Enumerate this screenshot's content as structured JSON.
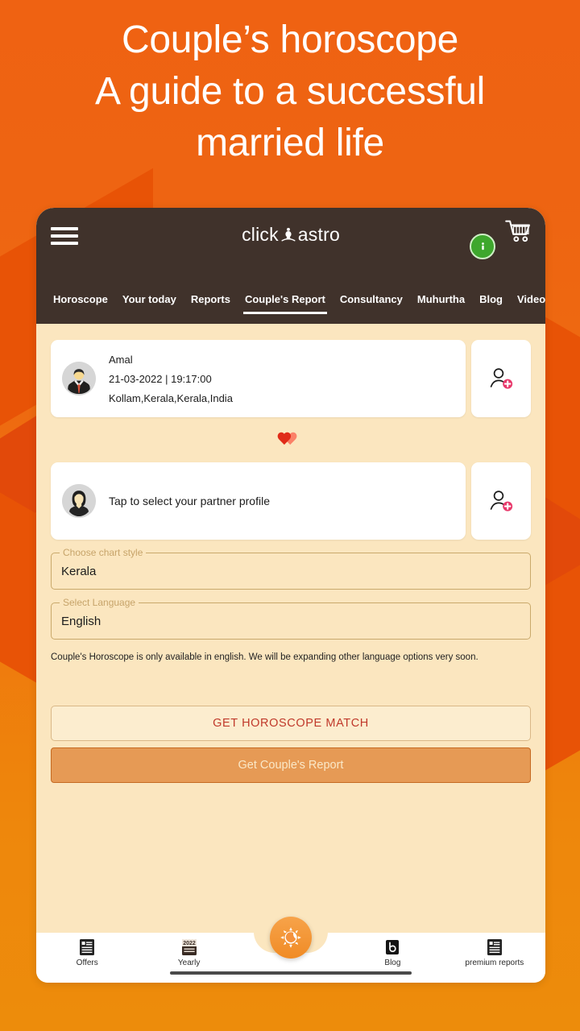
{
  "headline": {
    "line1": "Couple’s horoscope",
    "line2": "A guide to a successful",
    "line3": "married life"
  },
  "appbar": {
    "menu_icon": "hamburger-menu-icon",
    "logo_prefix": "click",
    "logo_suffix": "astro",
    "logo_glyph": "astro-figure-icon",
    "info_badge_label": "i",
    "cart_icon": "shopping-cart-icon"
  },
  "nav_tabs": [
    {
      "label": "Horoscope",
      "active": false
    },
    {
      "label": "Your today",
      "active": false
    },
    {
      "label": "Reports",
      "active": false
    },
    {
      "label": "Couple's Report",
      "active": true
    },
    {
      "label": "Consultancy",
      "active": false
    },
    {
      "label": "Muhurtha",
      "active": false
    },
    {
      "label": "Blog",
      "active": false
    },
    {
      "label": "Videos",
      "active": false
    }
  ],
  "self_profile": {
    "avatar": "male-avatar",
    "name": "Amal",
    "datetime": "21-03-2022 | 19:17:00",
    "place": "Kollam,Kerala,Kerala,India",
    "add_button_icon": "add-person-icon"
  },
  "hearts_icon": "two-hearts-icon",
  "partner_profile": {
    "avatar": "female-avatar",
    "placeholder": "Tap to select your partner profile",
    "add_button_icon": "add-person-icon"
  },
  "fields": [
    {
      "label": "Choose chart style",
      "value": "Kerala"
    },
    {
      "label": "Select Language",
      "value": "English"
    }
  ],
  "helper_text": "Couple's Horoscope is only available in english. We will be expanding other language options very soon.",
  "buttons": {
    "match": "GET HOROSCOPE MATCH",
    "report": "Get Couple's Report"
  },
  "bottom_nav": [
    {
      "label": "Offers",
      "icon": "list-document-icon"
    },
    {
      "label": "Yearly",
      "icon": "calendar-2022-icon",
      "badge": "2022"
    },
    {
      "label": "Blog",
      "icon": "blog-b-icon"
    },
    {
      "label": "premium reports",
      "icon": "list-document-icon"
    }
  ],
  "fab": {
    "icon": "sun-moon-icon"
  },
  "colors": {
    "background_top": "#EF6212",
    "background_bottom": "#ED8C0B",
    "appbar": "#40322B",
    "panel": "#FBE6BF",
    "accent_orange": "#E69A55",
    "match_text": "#C0392B",
    "badge_green": "#3EA72D",
    "add_badge_pink": "#E8396B"
  }
}
